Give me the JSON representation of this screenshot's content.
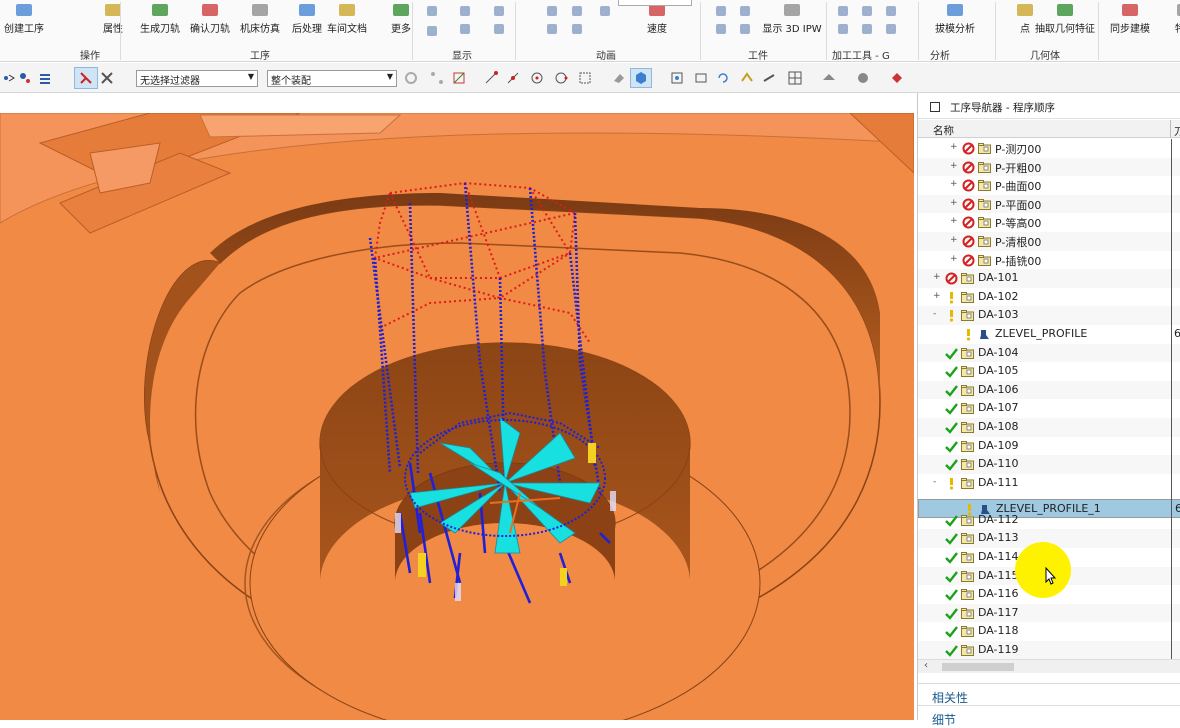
{
  "ribbon": {
    "buttons": [
      {
        "label": "创建工序",
        "icon": "create-operation-icon"
      },
      {
        "label": "属性",
        "icon": "properties-icon"
      },
      {
        "label": "生成刀轨",
        "icon": "generate-toolpath-icon"
      },
      {
        "label": "确认刀轨",
        "icon": "verify-toolpath-icon"
      },
      {
        "label": "机床仿真",
        "icon": "machine-simulation-icon"
      },
      {
        "label": "后处理",
        "icon": "postprocess-icon"
      },
      {
        "label": "车间文档",
        "icon": "shop-doc-icon"
      },
      {
        "label": "更多",
        "icon": "more-icon"
      },
      {
        "label": "速度",
        "icon": "speed-icon"
      },
      {
        "label": "显示 3D IPW",
        "icon": "show-3d-ipw-icon"
      },
      {
        "label": "拔模分析",
        "icon": "draft-analysis-icon"
      },
      {
        "label": "点",
        "icon": "point-icon"
      },
      {
        "label": "抽取几何特征",
        "icon": "extract-geometry-icon"
      },
      {
        "label": "同步建模",
        "icon": "sync-modeling-icon"
      },
      {
        "label": "特征",
        "icon": "feature-icon"
      }
    ],
    "groups": [
      "操作",
      "工序",
      "显示",
      "动画",
      "工件",
      "加工工具 - G",
      "分析",
      "几何体"
    ]
  },
  "toolbar": {
    "filter_select": "无选择过滤器",
    "assembly_select": "整个装配"
  },
  "navigator": {
    "title": "工序导航器 - 程序顺序",
    "column_name": "名称",
    "column_2": "刀",
    "rows": [
      {
        "label": "P-测刃00",
        "status": "forbidden",
        "indent": 1,
        "expand": "+"
      },
      {
        "label": "P-开粗00",
        "status": "forbidden",
        "indent": 1,
        "expand": "+"
      },
      {
        "label": "P-曲面00",
        "status": "forbidden",
        "indent": 1,
        "expand": "+"
      },
      {
        "label": "P-平面00",
        "status": "forbidden",
        "indent": 1,
        "expand": "+"
      },
      {
        "label": "P-等高00",
        "status": "forbidden",
        "indent": 1,
        "expand": "+"
      },
      {
        "label": "P-清根00",
        "status": "forbidden",
        "indent": 1,
        "expand": "+"
      },
      {
        "label": "P-插铣00",
        "status": "forbidden",
        "indent": 1,
        "expand": "+"
      },
      {
        "label": "DA-101",
        "status": "forbidden",
        "indent": 0,
        "expand": "+"
      },
      {
        "label": "DA-102",
        "status": "warning",
        "indent": 0,
        "expand": "+"
      },
      {
        "label": "DA-103",
        "status": "warning",
        "indent": 0,
        "expand": "-"
      },
      {
        "label": "ZLEVEL_PROFILE",
        "status": "warning",
        "indent": 1,
        "expand": "",
        "op": true,
        "value": "6"
      },
      {
        "label": "DA-104",
        "status": "ok",
        "indent": 0,
        "expand": ""
      },
      {
        "label": "DA-105",
        "status": "ok",
        "indent": 0,
        "expand": ""
      },
      {
        "label": "DA-106",
        "status": "ok",
        "indent": 0,
        "expand": ""
      },
      {
        "label": "DA-107",
        "status": "ok",
        "indent": 0,
        "expand": ""
      },
      {
        "label": "DA-108",
        "status": "ok",
        "indent": 0,
        "expand": ""
      },
      {
        "label": "DA-109",
        "status": "ok",
        "indent": 0,
        "expand": ""
      },
      {
        "label": "DA-110",
        "status": "ok",
        "indent": 0,
        "expand": ""
      },
      {
        "label": "DA-111",
        "status": "warning",
        "indent": 0,
        "expand": "-"
      },
      {
        "label": "ZLEVEL_PROFILE_1",
        "status": "warning",
        "indent": 1,
        "expand": "",
        "op": true,
        "selected": true,
        "value": "6"
      },
      {
        "label": "DA-112",
        "status": "ok",
        "indent": 0,
        "expand": ""
      },
      {
        "label": "DA-113",
        "status": "ok",
        "indent": 0,
        "expand": ""
      },
      {
        "label": "DA-114",
        "status": "ok",
        "indent": 0,
        "expand": ""
      },
      {
        "label": "DA-115",
        "status": "ok",
        "indent": 0,
        "expand": ""
      },
      {
        "label": "DA-116",
        "status": "ok",
        "indent": 0,
        "expand": ""
      },
      {
        "label": "DA-117",
        "status": "ok",
        "indent": 0,
        "expand": ""
      },
      {
        "label": "DA-118",
        "status": "ok",
        "indent": 0,
        "expand": ""
      },
      {
        "label": "DA-119",
        "status": "ok",
        "indent": 0,
        "expand": ""
      }
    ],
    "sections": [
      "相关性",
      "细节"
    ]
  },
  "colors": {
    "part_orange": "#f08a45",
    "toolpath_blue": "#1f20d8",
    "toolpath_red": "#e01a1a",
    "cut_cyan": "#19e0e0",
    "selection": "#9fc9e0",
    "check_green": "#1aa31a",
    "forbid_red": "#d42020",
    "warn_yellow": "#e8b800"
  }
}
